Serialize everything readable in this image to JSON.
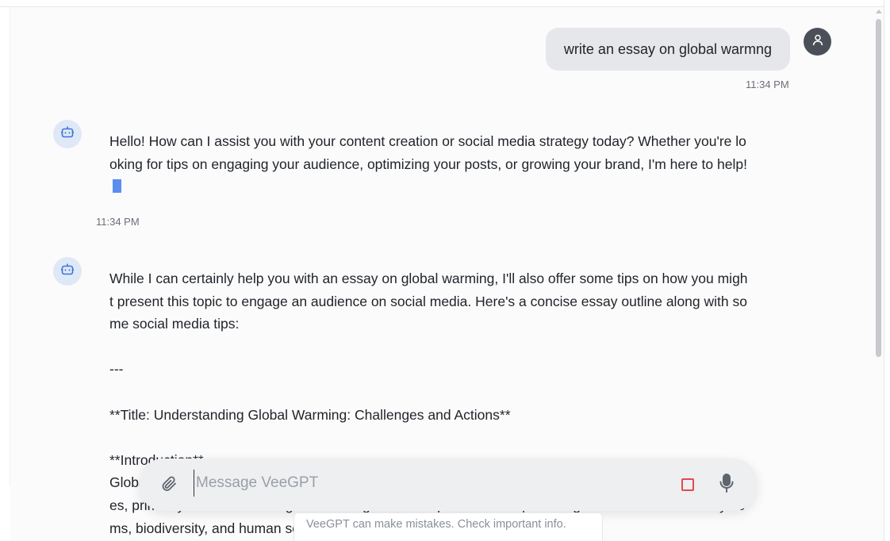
{
  "messages": {
    "user": {
      "text": "write an essay on global warmng",
      "time": "11:34 PM"
    },
    "bot1": {
      "text": "Hello! How can I assist you with your content creation or social media strategy today? Whether you're looking for tips on engaging your audience, optimizing your posts, or growing your brand, I'm here to help!",
      "time": "11:34 PM"
    },
    "bot2": {
      "text": "While I can certainly help you with an essay on global warming, I'll also offer some tips on how you might present this topic to engage an audience on social media. Here's a concise essay outline along with some social media tips:\n\n---\n\n**Title: Understanding Global Warming: Challenges and Actions**\n\n**Introduction**\nGlobal warming refers to the long-term rise in Earth's average surface temperature due to human activities, primarily the emission of greenhouse gases. This phenomenon poses significant threats to ecosystems, biodiversity, and human societi"
    }
  },
  "composer": {
    "placeholder": "Message VeeGPT",
    "value": ""
  },
  "disclaimer": "VeeGPT can make mistakes. Check important info.",
  "icons": {
    "user_avatar": "user-icon",
    "bot_avatar": "robot-icon",
    "attach": "paperclip-icon",
    "stop": "stop-square-icon",
    "mic": "microphone-icon"
  },
  "colors": {
    "accent": "#5b8def",
    "stop": "#e5484d",
    "bot_avatar_bg": "#dfe8f6",
    "user_avatar_bg": "#4b5058"
  }
}
